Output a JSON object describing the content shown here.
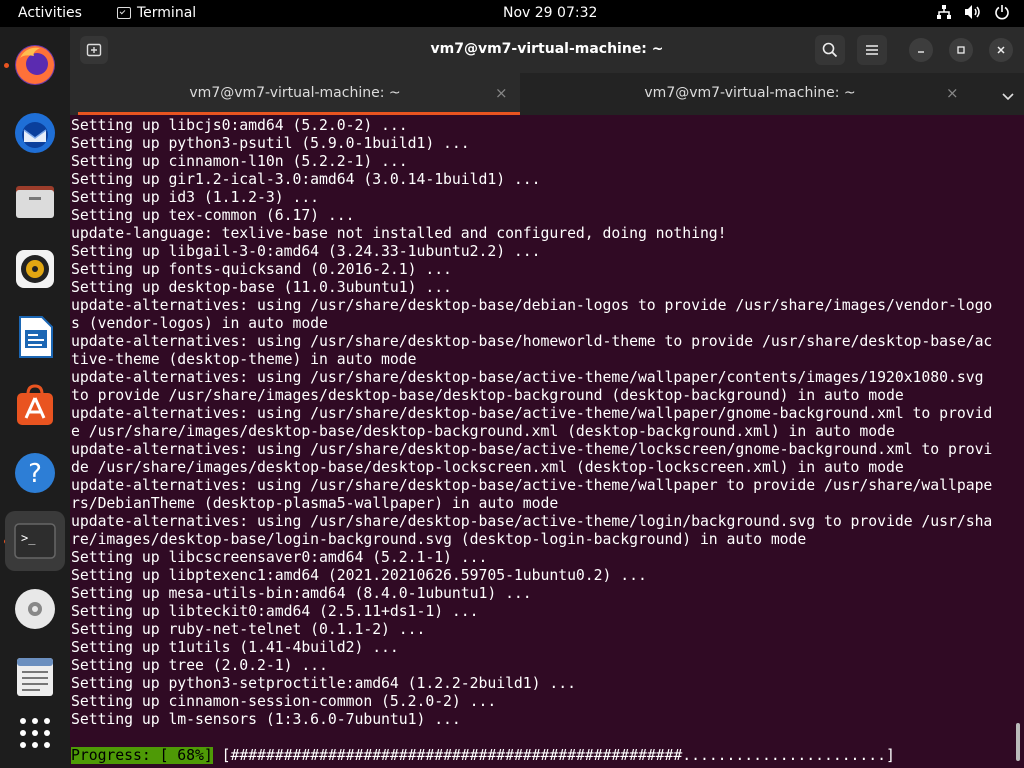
{
  "topbar": {
    "activities": "Activities",
    "app_name": "Terminal",
    "clock": "Nov 29  07:32",
    "tray_icons": [
      "network-icon",
      "volume-icon",
      "power-icon"
    ]
  },
  "dock": {
    "apps": [
      "Firefox",
      "Thunderbird",
      "Files",
      "Rhythmbox",
      "LibreOffice Writer",
      "Ubuntu Software",
      "Help",
      "Terminal",
      "Disc",
      "Text Editor",
      "Show Applications"
    ]
  },
  "window": {
    "title": "vm7@vm7-virtual-machine: ~",
    "tabs": [
      {
        "label": "vm7@vm7-virtual-machine: ~",
        "close": "×"
      },
      {
        "label": "vm7@vm7-virtual-machine: ~",
        "close": "×"
      }
    ]
  },
  "terminal": {
    "lines": [
      "Setting up libcjs0:amd64 (5.2.0-2) ...",
      "Setting up python3-psutil (5.9.0-1build1) ...",
      "Setting up cinnamon-l10n (5.2.2-1) ...",
      "Setting up gir1.2-ical-3.0:amd64 (3.0.14-1build1) ...",
      "Setting up id3 (1.1.2-3) ...",
      "Setting up tex-common (6.17) ...",
      "update-language: texlive-base not installed and configured, doing nothing!",
      "Setting up libgail-3-0:amd64 (3.24.33-1ubuntu2.2) ...",
      "Setting up fonts-quicksand (0.2016-2.1) ...",
      "Setting up desktop-base (11.0.3ubuntu1) ...",
      "update-alternatives: using /usr/share/desktop-base/debian-logos to provide /usr/share/images/vendor-logo",
      "s (vendor-logos) in auto mode",
      "update-alternatives: using /usr/share/desktop-base/homeworld-theme to provide /usr/share/desktop-base/ac",
      "tive-theme (desktop-theme) in auto mode",
      "update-alternatives: using /usr/share/desktop-base/active-theme/wallpaper/contents/images/1920x1080.svg",
      "to provide /usr/share/images/desktop-base/desktop-background (desktop-background) in auto mode",
      "update-alternatives: using /usr/share/desktop-base/active-theme/wallpaper/gnome-background.xml to provid",
      "e /usr/share/images/desktop-base/desktop-background.xml (desktop-background.xml) in auto mode",
      "update-alternatives: using /usr/share/desktop-base/active-theme/lockscreen/gnome-background.xml to provi",
      "de /usr/share/images/desktop-base/desktop-lockscreen.xml (desktop-lockscreen.xml) in auto mode",
      "update-alternatives: using /usr/share/desktop-base/active-theme/wallpaper to provide /usr/share/wallpape",
      "rs/DebianTheme (desktop-plasma5-wallpaper) in auto mode",
      "update-alternatives: using /usr/share/desktop-base/active-theme/login/background.svg to provide /usr/sha",
      "re/images/desktop-base/login-background.svg (desktop-login-background) in auto mode",
      "Setting up libcscreensaver0:amd64 (5.2.1-1) ...",
      "Setting up libptexenc1:amd64 (2021.20210626.59705-1ubuntu0.2) ...",
      "Setting up mesa-utils-bin:amd64 (8.4.0-1ubuntu1) ...",
      "Setting up libteckit0:amd64 (2.5.11+ds1-1) ...",
      "Setting up ruby-net-telnet (0.1.1-2) ...",
      "Setting up t1utils (1.41-4build2) ...",
      "Setting up tree (2.0.2-1) ...",
      "Setting up python3-setproctitle:amd64 (1.2.2-2build1) ...",
      "Setting up cinnamon-session-common (5.2.0-2) ...",
      "Setting up lm-sensors (1:3.6.0-7ubuntu1) ..."
    ],
    "progress_label": "Progress: [ 68%]",
    "progress_bar": " [###################################################.......................]",
    "progress_percent": 68
  },
  "colors": {
    "terminal_bg": "#300a24",
    "accent": "#e95420",
    "progress_bg": "#4e9a06"
  }
}
